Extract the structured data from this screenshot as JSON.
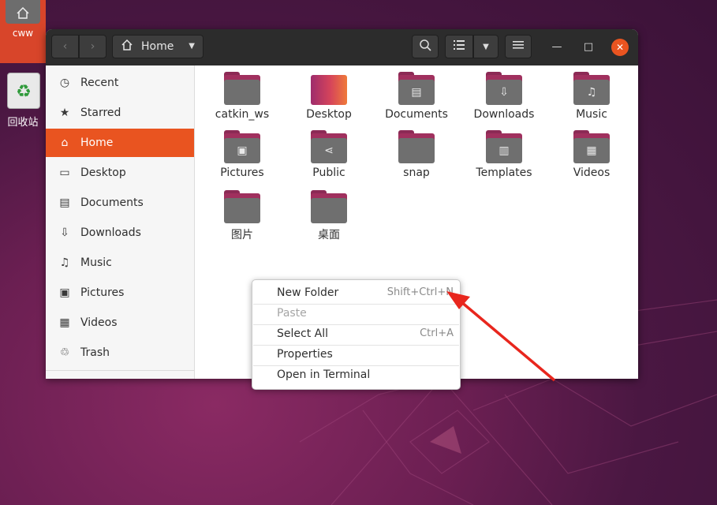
{
  "desktop": {
    "home_label": "cww",
    "trash_label": "回收站"
  },
  "headerbar": {
    "path_title": "Home",
    "back_glyph": "‹",
    "forward_glyph": "›",
    "dropdown_glyph": "▼",
    "search_icon": "search-icon",
    "list_view_icon": "list-view-icon",
    "menu_icon": "hamburger-menu-icon",
    "minimize_glyph": "—",
    "maximize_glyph": "□",
    "close_glyph": "✕"
  },
  "sidebar": {
    "items": [
      {
        "label": "Recent",
        "icon": "clock-icon",
        "glyph": "◷"
      },
      {
        "label": "Starred",
        "icon": "star-icon",
        "glyph": "★"
      },
      {
        "label": "Home",
        "icon": "home-icon",
        "glyph": "⌂"
      },
      {
        "label": "Desktop",
        "icon": "desktop-icon",
        "glyph": "▭"
      },
      {
        "label": "Documents",
        "icon": "document-icon",
        "glyph": "▤"
      },
      {
        "label": "Downloads",
        "icon": "download-icon",
        "glyph": "⇩"
      },
      {
        "label": "Music",
        "icon": "music-icon",
        "glyph": "♫"
      },
      {
        "label": "Pictures",
        "icon": "picture-icon",
        "glyph": "▣"
      },
      {
        "label": "Videos",
        "icon": "video-icon",
        "glyph": "▦"
      },
      {
        "label": "Trash",
        "icon": "trash-icon",
        "glyph": "♲"
      }
    ],
    "active": "Home"
  },
  "files": [
    {
      "name": "catkin_ws",
      "emblem": ""
    },
    {
      "name": "Desktop",
      "emblem": ""
    },
    {
      "name": "Documents",
      "emblem": "▤"
    },
    {
      "name": "Downloads",
      "emblem": "⇩"
    },
    {
      "name": "Music",
      "emblem": "♫"
    },
    {
      "name": "Pictures",
      "emblem": "▣"
    },
    {
      "name": "Public",
      "emblem": "⋖"
    },
    {
      "name": "snap",
      "emblem": ""
    },
    {
      "name": "Templates",
      "emblem": "▥"
    },
    {
      "name": "Videos",
      "emblem": "▦"
    },
    {
      "name": "图片",
      "emblem": ""
    },
    {
      "name": "桌面",
      "emblem": ""
    }
  ],
  "context_menu": {
    "items": [
      {
        "label": "New Folder",
        "shortcut": "Shift+Ctrl+N",
        "enabled": true
      },
      {
        "label": "Paste",
        "shortcut": "",
        "enabled": false
      },
      {
        "label": "Select All",
        "shortcut": "Ctrl+A",
        "enabled": true
      },
      {
        "label": "Properties",
        "shortcut": "",
        "enabled": true
      },
      {
        "label": "Open in Terminal",
        "shortcut": "",
        "enabled": true
      }
    ]
  },
  "colors": {
    "accent": "#e95420",
    "headerbar": "#2c2c2c",
    "annotation_arrow": "#e8261d"
  }
}
